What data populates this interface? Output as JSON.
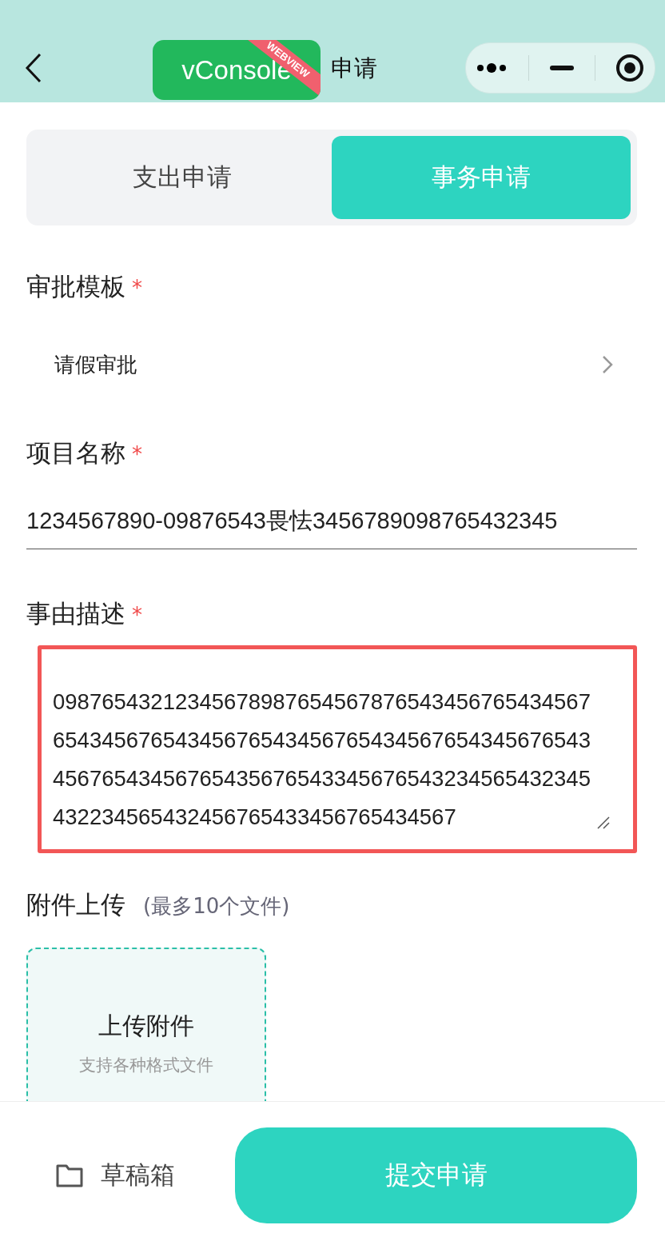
{
  "header": {
    "title": "申请",
    "debug_badge": {
      "label": "vConsole",
      "ribbon": "WEBVIEW"
    }
  },
  "tabs": [
    {
      "label": "支出申请",
      "selected": false
    },
    {
      "label": "事务申请",
      "selected": true
    }
  ],
  "fields": [
    {
      "kind": "picker",
      "label": "审批模板",
      "required_mark": "*",
      "value": "请假审批"
    },
    {
      "kind": "input",
      "label": "项目名称",
      "required_mark": "*",
      "value": "1234567890-09876543畏怯3456789098765432345"
    },
    {
      "kind": "textarea",
      "label": "事由描述",
      "required_mark": "*",
      "highlighted": true,
      "value_lines": [
        "09876543212345678987654567876543456765434567",
        "65434567654345676543456765434567654345676543",
        "45676543456765435676543345676543234565432345",
        "432234565432456765433456765434567"
      ]
    },
    {
      "kind": "upload",
      "label": "附件上传",
      "hint": "(最多10个文件)",
      "button": "上传附件",
      "note": "支持各种格式文件"
    }
  ],
  "footer": {
    "drafts": "草稿箱",
    "submit": "提交申请"
  }
}
